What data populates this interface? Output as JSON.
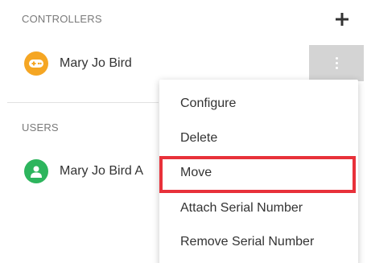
{
  "controllers_section": {
    "header": "CONTROLLERS",
    "add_icon": "plus-icon",
    "items": [
      {
        "name": "Mary Jo Bird",
        "icon": "gamepad-icon",
        "icon_color": "#f5a623"
      }
    ],
    "more_icon": "vertical-ellipsis-icon"
  },
  "users_section": {
    "header": "USERS",
    "items": [
      {
        "name": "Mary Jo Bird A",
        "icon": "person-icon",
        "icon_color": "#2db55d"
      }
    ]
  },
  "context_menu": {
    "items": [
      {
        "label": "Configure"
      },
      {
        "label": "Delete"
      },
      {
        "label": "Move"
      },
      {
        "label": "Attach Serial Number"
      },
      {
        "label": "Remove Serial Number"
      }
    ],
    "highlighted_item": "Move",
    "highlight_color": "#e8313a"
  }
}
